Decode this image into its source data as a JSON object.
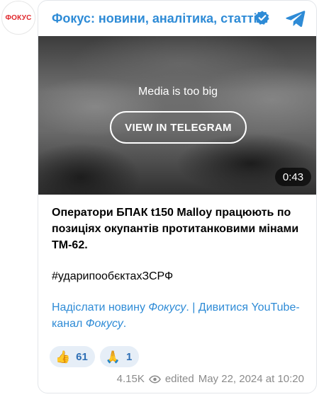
{
  "avatar": {
    "text": "ФОКУС"
  },
  "header": {
    "channel_name": "Фокус: новини, аналітика, статті",
    "verified_icon": "verified-badge-icon",
    "telegram_icon": "telegram-logo-icon"
  },
  "media": {
    "message": "Media is too big",
    "button_label": "VIEW IN TELEGRAM",
    "duration": "0:43"
  },
  "post": {
    "text": "Оператори БПАК t150 Malloy працюють по позиціях окупантів протитанковими мінами ТМ-62.",
    "hashtag": "#ударипообєктахЗСРФ",
    "link_send": "Надіслати новину ",
    "link_send_em": "Фокусу",
    "separator": ". | ",
    "link_watch": "Дивитися YouTube-канал ",
    "link_watch_em": "Фокусу",
    "trailing": "."
  },
  "reactions": [
    {
      "emoji": "👍",
      "icon": "thumbs-up-icon",
      "count": "61"
    },
    {
      "emoji": "🙏",
      "icon": "folded-hands-icon",
      "count": "1"
    }
  ],
  "footer": {
    "views": "4.15K",
    "edited": "edited",
    "date": "May 22, 2024 at 10:20"
  },
  "colors": {
    "accent": "#2e8bd6",
    "brand_red": "#e0262b",
    "reaction_bg": "#e6eef7"
  }
}
